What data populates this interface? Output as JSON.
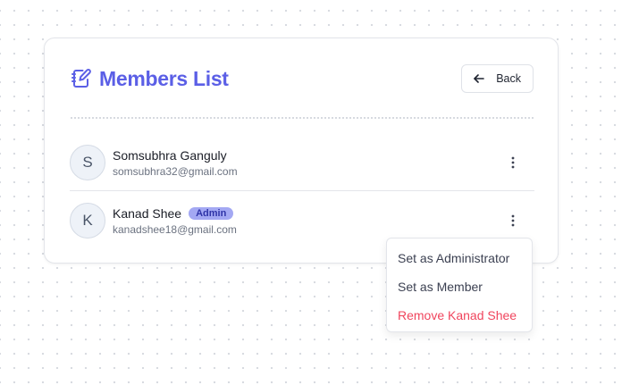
{
  "header": {
    "title": "Members List",
    "title_icon": "notebook-edit-icon",
    "back_label": "Back",
    "back_icon": "arrow-left-icon",
    "accent_color": "#5b5fe6"
  },
  "members": [
    {
      "initial": "S",
      "name": "Somsubhra Ganguly",
      "email": "somsubhra32@gmail.com",
      "badge": ""
    },
    {
      "initial": "K",
      "name": "Kanad Shee",
      "email": "kanadshee18@gmail.com",
      "badge": "Admin"
    }
  ],
  "context_menu": {
    "items": [
      {
        "label": "Set as Administrator",
        "color": "#3c4152"
      },
      {
        "label": "Set as Member",
        "color": "#3c4152"
      },
      {
        "label": "Remove Kanad Shee",
        "color": "#f0455d"
      }
    ]
  }
}
